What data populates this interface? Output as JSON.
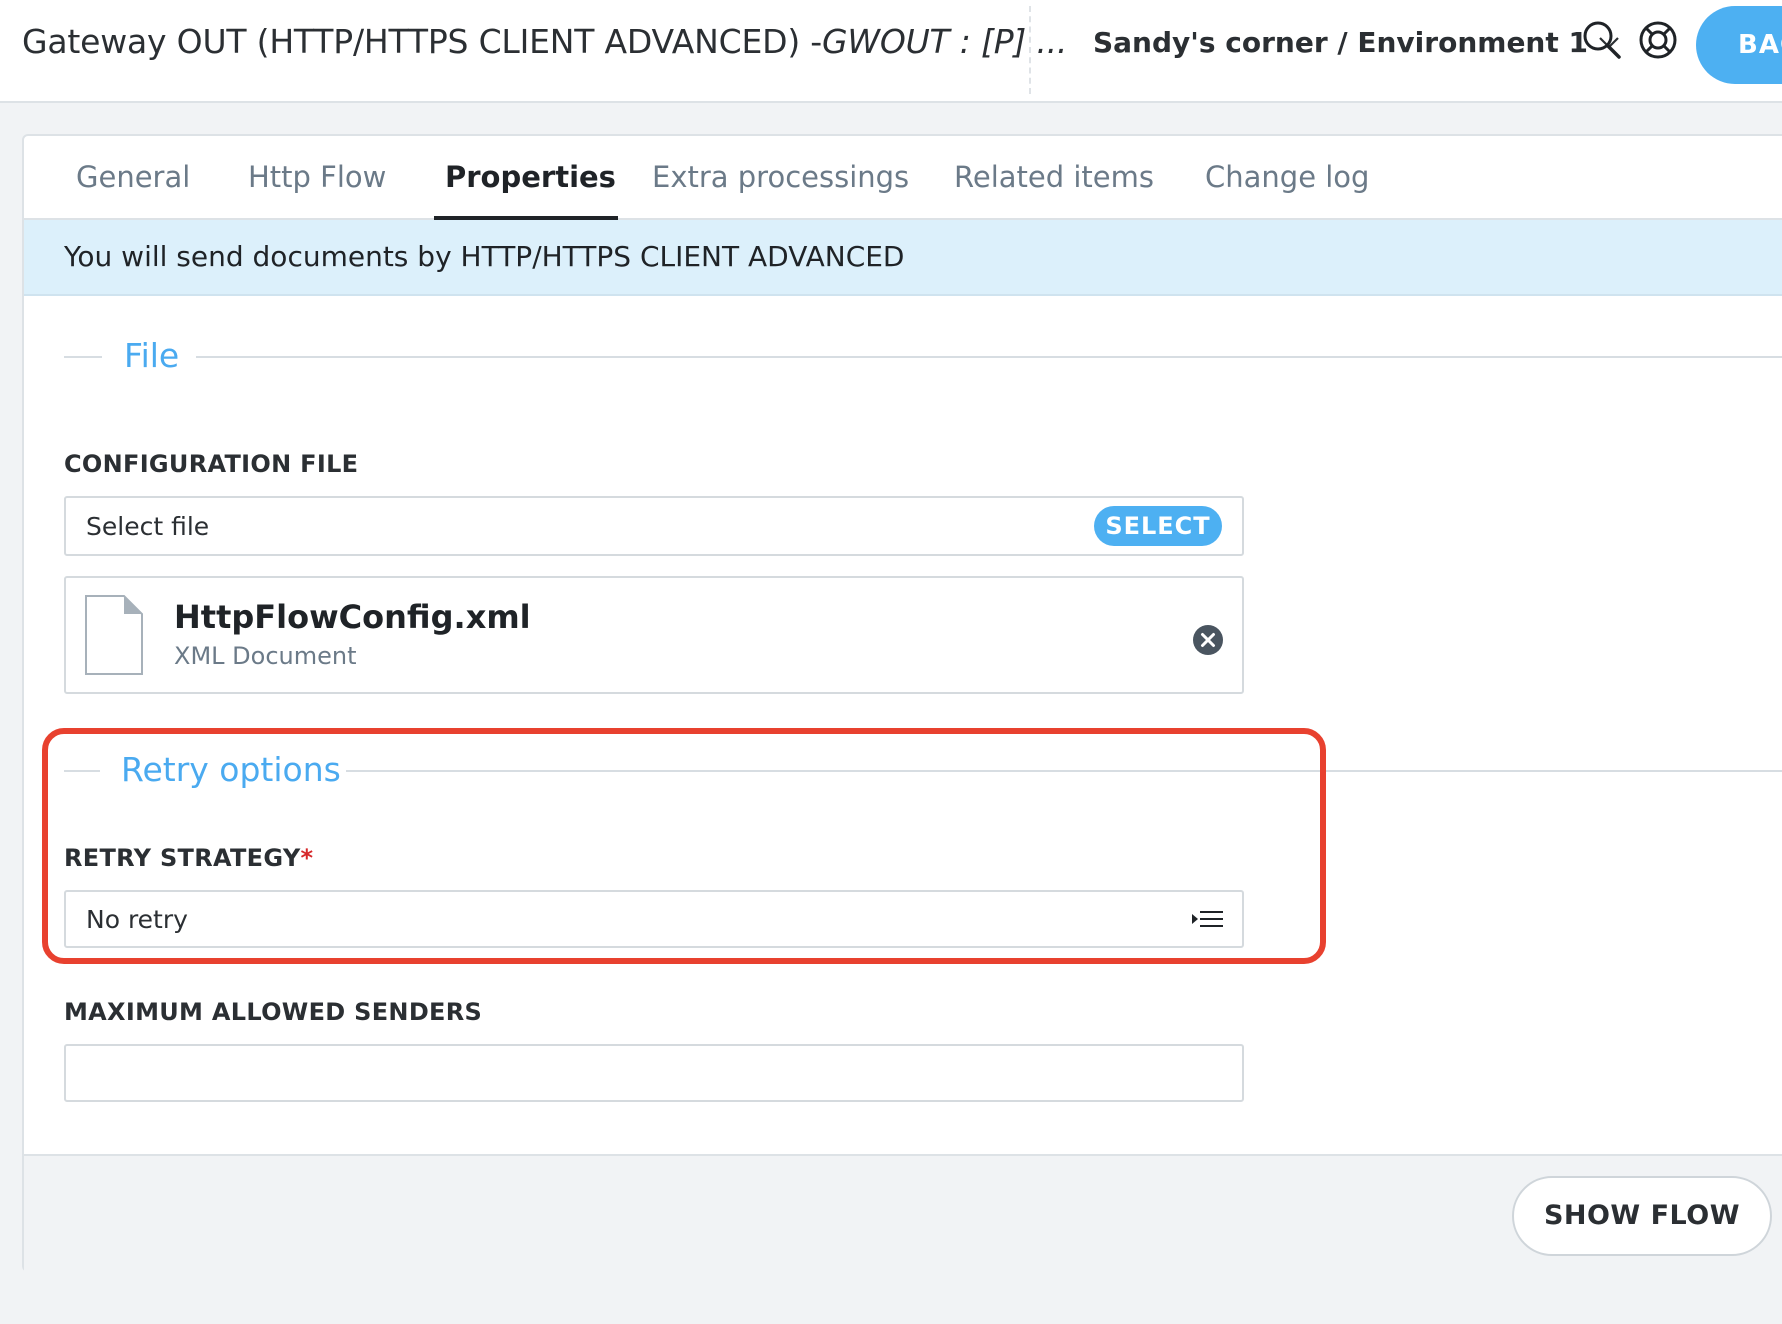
{
  "header": {
    "title_main": "Gateway OUT (HTTP/HTTPS CLIENT ADVANCED) -",
    "title_code": "GWOUT : [P] ...",
    "environment": "Sandy's corner / Environment 1",
    "back_button": "BAC",
    "icons": [
      "search-icon",
      "help-lifebuoy-icon",
      "chevron-down-icon"
    ]
  },
  "tabs": [
    {
      "label": "General"
    },
    {
      "label": "Http Flow"
    },
    {
      "label": "Properties",
      "active": true
    },
    {
      "label": "Extra processings"
    },
    {
      "label": "Related items"
    },
    {
      "label": "Change log"
    }
  ],
  "banner": "You will send documents by HTTP/HTTPS CLIENT ADVANCED",
  "file_section": {
    "title": "File",
    "config_label": "CONFIGURATION FILE",
    "placeholder": "Select file",
    "select_button": "SELECT",
    "file": {
      "name": "HttpFlowConfig.xml",
      "type": "XML Document"
    }
  },
  "retry_section": {
    "title": "Retry options",
    "strategy_label": "RETRY STRATEGY",
    "required_mark": "*",
    "strategy_value": "No retry"
  },
  "max_senders": {
    "label": "MAXIMUM ALLOWED SENDERS",
    "value": ""
  },
  "footer": {
    "show_flow_button": "SHOW FLOW"
  },
  "colors": {
    "accent": "#4db0f2",
    "section_title": "#4aaaf0",
    "banner_bg": "#dcf0fb",
    "highlight": "#e8412f",
    "required": "#d6282a"
  }
}
